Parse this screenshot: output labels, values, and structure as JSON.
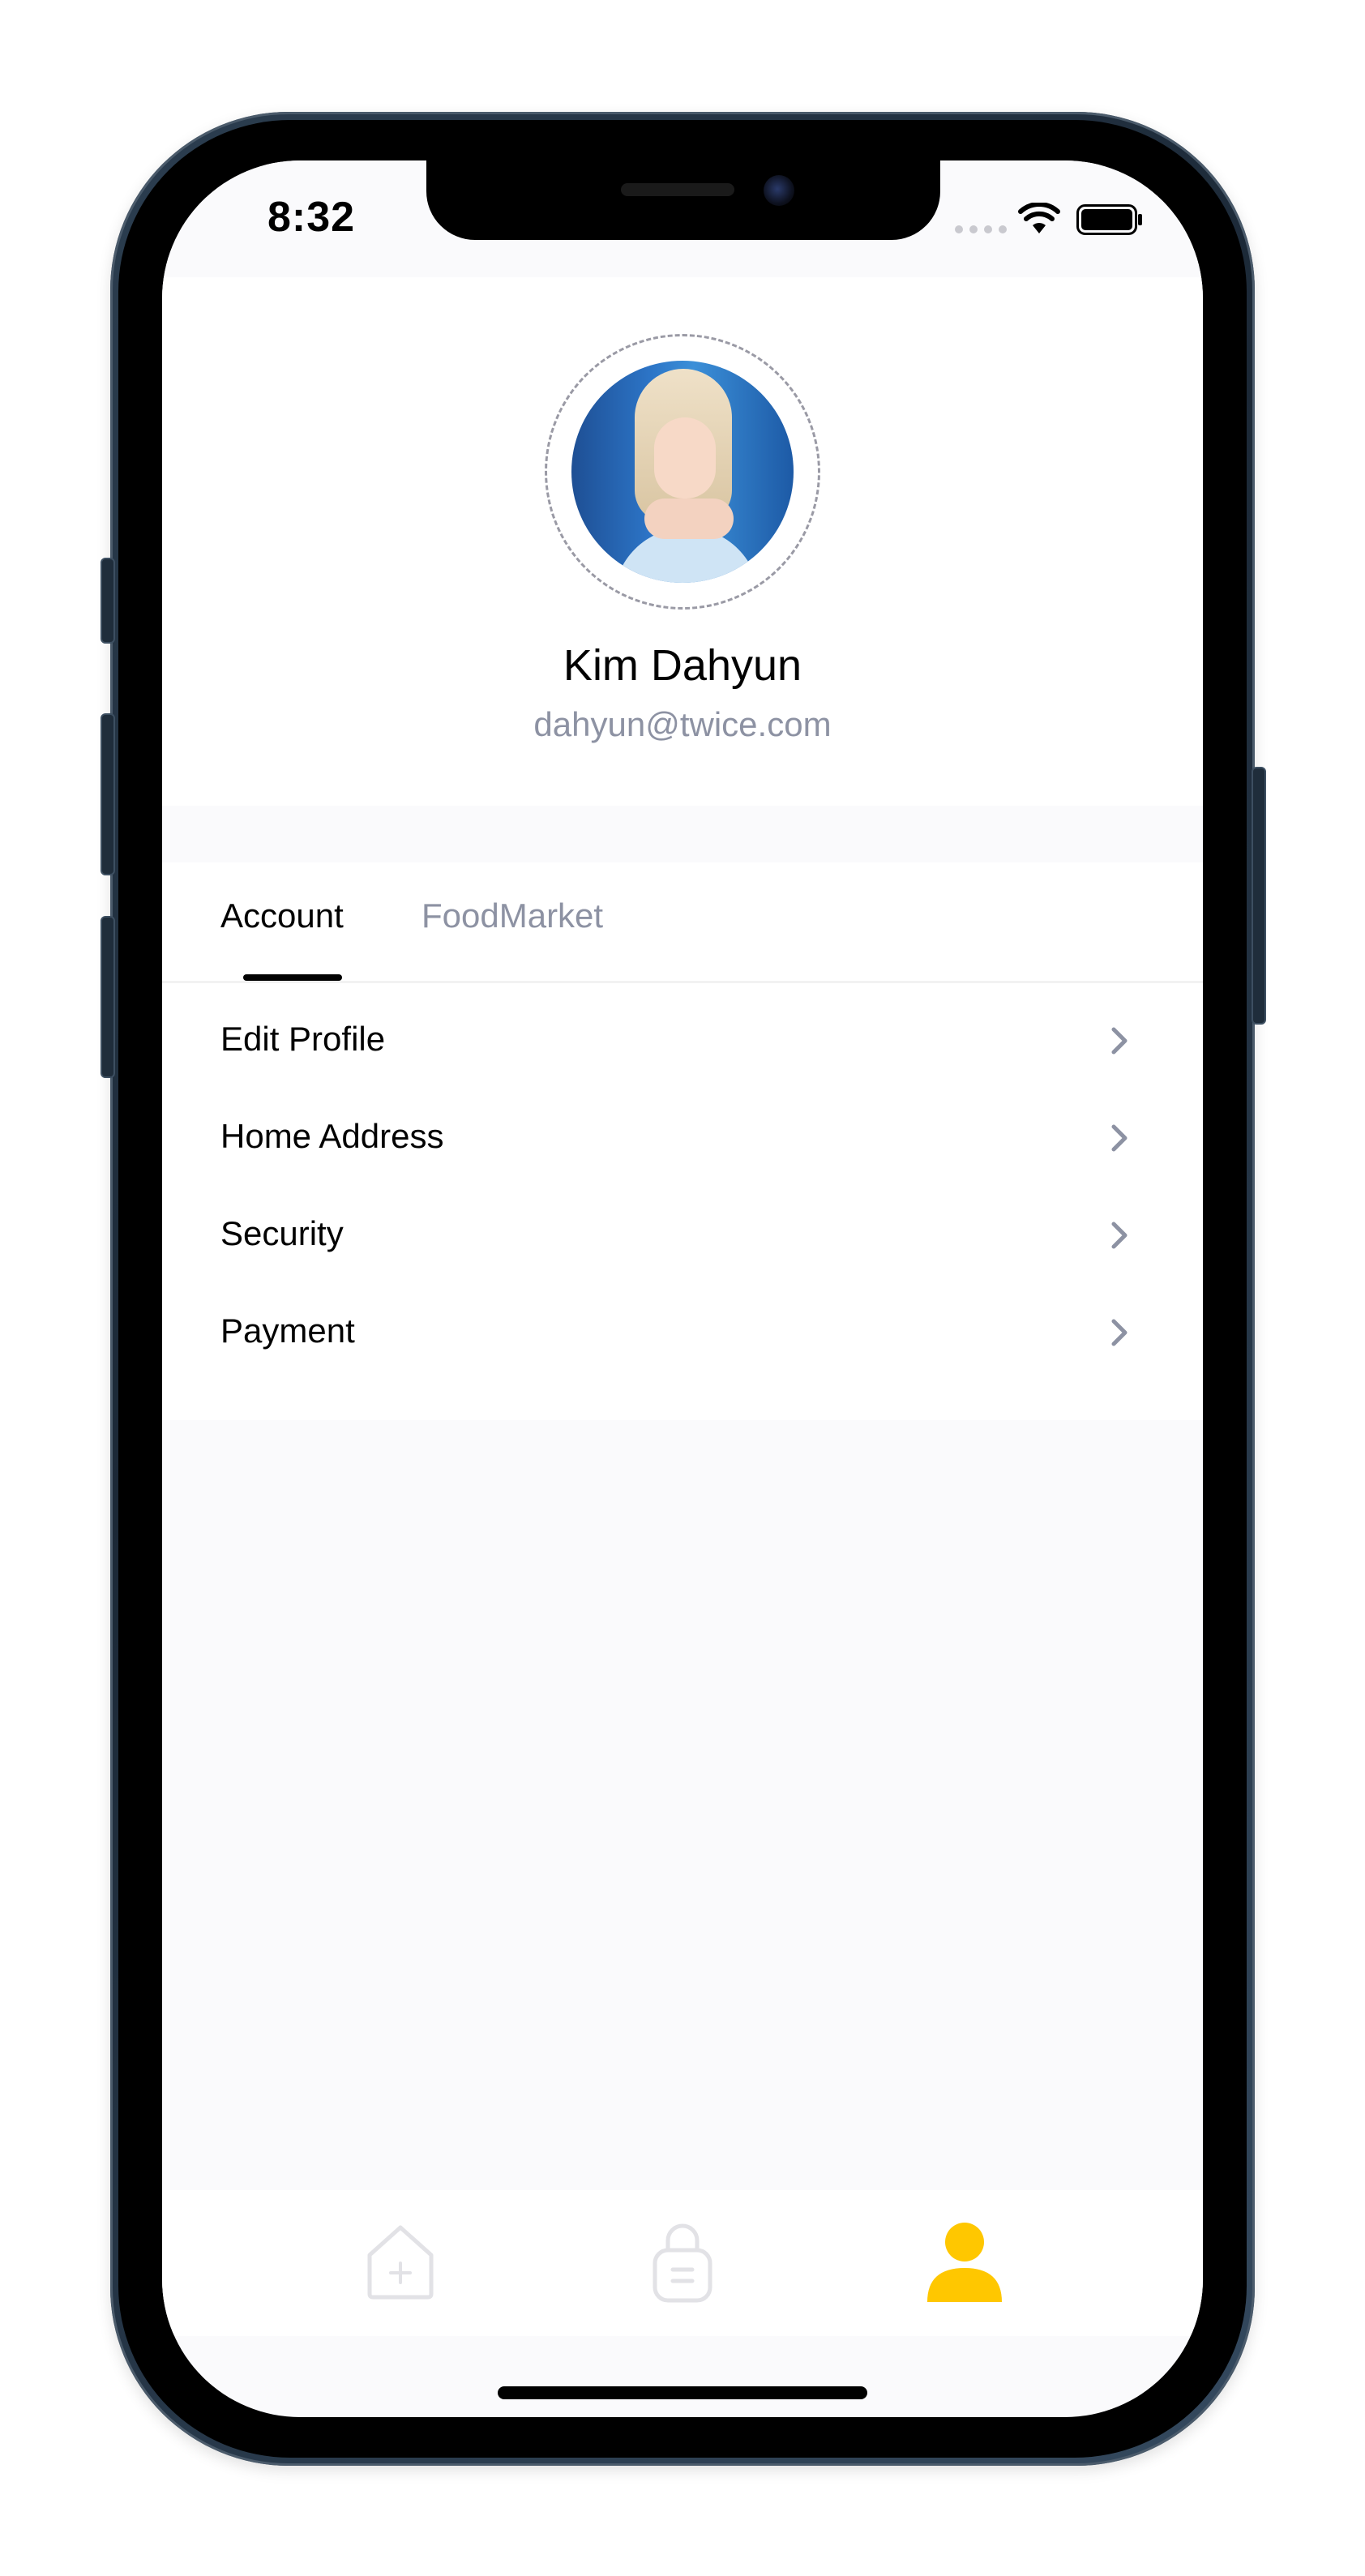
{
  "status_bar": {
    "time": "8:32"
  },
  "profile": {
    "name": "Kim Dahyun",
    "email": "dahyun@twice.com"
  },
  "tabs": [
    {
      "label": "Account",
      "active": true
    },
    {
      "label": "FoodMarket",
      "active": false
    }
  ],
  "menu": {
    "items": [
      {
        "label": "Edit Profile",
        "icon": "chevron-right-icon"
      },
      {
        "label": "Home Address",
        "icon": "chevron-right-icon"
      },
      {
        "label": "Security",
        "icon": "chevron-right-icon"
      },
      {
        "label": "Payment",
        "icon": "chevron-right-icon"
      }
    ]
  },
  "bottom_nav": {
    "items": [
      {
        "icon": "home-icon",
        "active": false
      },
      {
        "icon": "shopping-bag-icon",
        "active": false
      },
      {
        "icon": "user-icon",
        "active": true
      }
    ]
  },
  "colors": {
    "accent": "#FFC700",
    "text_primary": "#020202",
    "text_secondary": "#8D92A3",
    "background": "#FAFAFC",
    "icon_inactive": "#E2E2E6"
  }
}
